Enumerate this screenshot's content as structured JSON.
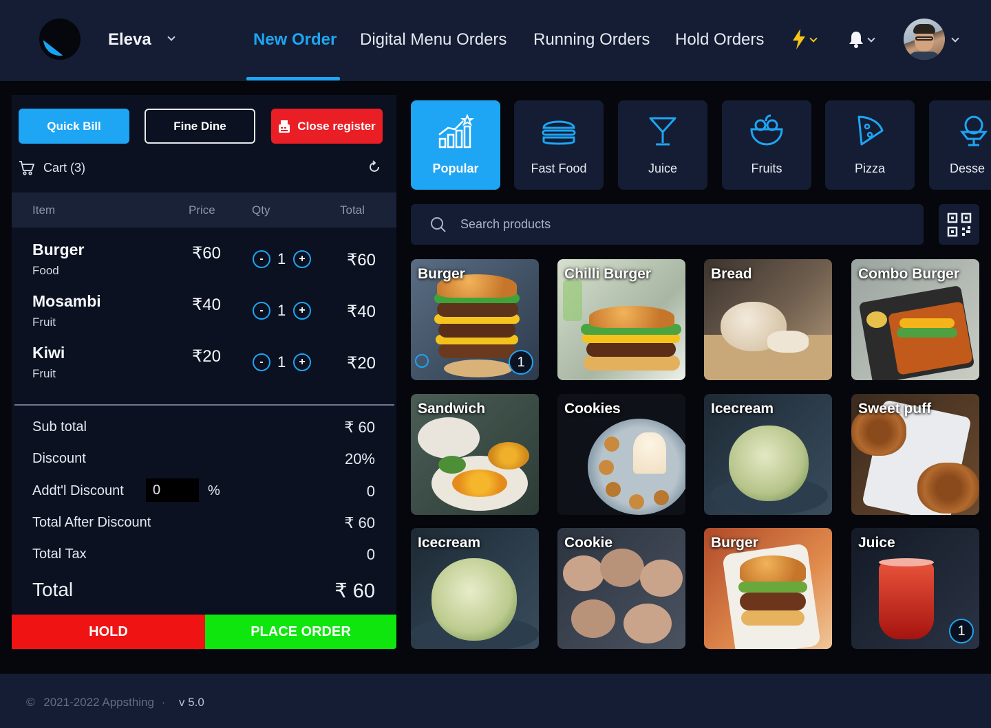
{
  "header": {
    "brand": "Eleva",
    "tabs": [
      {
        "label": "New Order",
        "active": true
      },
      {
        "label": "Digital Menu Orders",
        "active": false
      },
      {
        "label": "Running Orders",
        "active": false
      },
      {
        "label": "Hold Orders",
        "active": false
      }
    ],
    "icons": [
      "lightning-icon",
      "bell-icon",
      "avatar"
    ],
    "accent_color": "#1ea5f4",
    "lightning_color": "#f5c518"
  },
  "actions": {
    "quick_bill": "Quick Bill",
    "fine_dine": "Fine Dine",
    "close_register": "Close register"
  },
  "cart": {
    "label": "Cart (3)",
    "columns": {
      "item": "Item",
      "price": "Price",
      "qty": "Qty",
      "total": "Total"
    },
    "items": [
      {
        "name": "Burger",
        "category": "Food",
        "price": "₹60",
        "qty": "1",
        "total": "₹60"
      },
      {
        "name": "Mosambi",
        "category": "Fruit",
        "price": "₹40",
        "qty": "1",
        "total": "₹40"
      },
      {
        "name": "Kiwi",
        "category": "Fruit",
        "price": "₹20",
        "qty": "1",
        "total": "₹20"
      }
    ],
    "minus": "-",
    "plus": "+"
  },
  "summary": {
    "sub_total_label": "Sub total",
    "sub_total": "₹ 60",
    "discount_label": "Discount",
    "discount": "20%",
    "addl_discount_label": "Addt'l Discount",
    "addl_discount_input": "0",
    "addl_discount_unit": "%",
    "addl_discount": "0",
    "after_discount_label": "Total After Discount",
    "after_discount": "₹ 60",
    "tax_label": "Total Tax",
    "tax": "0",
    "total_label": "Total",
    "total": "₹ 60"
  },
  "buttons": {
    "hold": "HOLD",
    "place_order": "PLACE ORDER",
    "hold_color": "#f01313",
    "place_color": "#0ee60e"
  },
  "categories": [
    {
      "label": "Popular",
      "icon": "chart-star-icon",
      "active": true
    },
    {
      "label": "Fast Food",
      "icon": "burger-icon",
      "active": false
    },
    {
      "label": "Juice",
      "icon": "cocktail-icon",
      "active": false
    },
    {
      "label": "Fruits",
      "icon": "fruit-bowl-icon",
      "active": false
    },
    {
      "label": "Pizza",
      "icon": "pizza-icon",
      "active": false
    },
    {
      "label": "Desse",
      "icon": "dessert-icon",
      "active": false
    }
  ],
  "search": {
    "placeholder": "Search products"
  },
  "products": [
    {
      "name": "Burger",
      "badge": "1"
    },
    {
      "name": "Chilli Burger",
      "badge": ""
    },
    {
      "name": "Bread",
      "badge": ""
    },
    {
      "name": "Combo Burger",
      "badge": ""
    },
    {
      "name": "Sandwich",
      "badge": ""
    },
    {
      "name": "Cookies",
      "badge": ""
    },
    {
      "name": "Icecream",
      "badge": ""
    },
    {
      "name": "Sweet puff",
      "badge": ""
    },
    {
      "name": "Icecream",
      "badge": ""
    },
    {
      "name": "Cookie",
      "badge": ""
    },
    {
      "name": "Burger",
      "badge": ""
    },
    {
      "name": "Juice",
      "badge": "1"
    }
  ],
  "footer": {
    "copyright_symbol": "©",
    "copyright": "2021-2022 Appsthing",
    "separator": "·",
    "version": "v 5.0"
  }
}
